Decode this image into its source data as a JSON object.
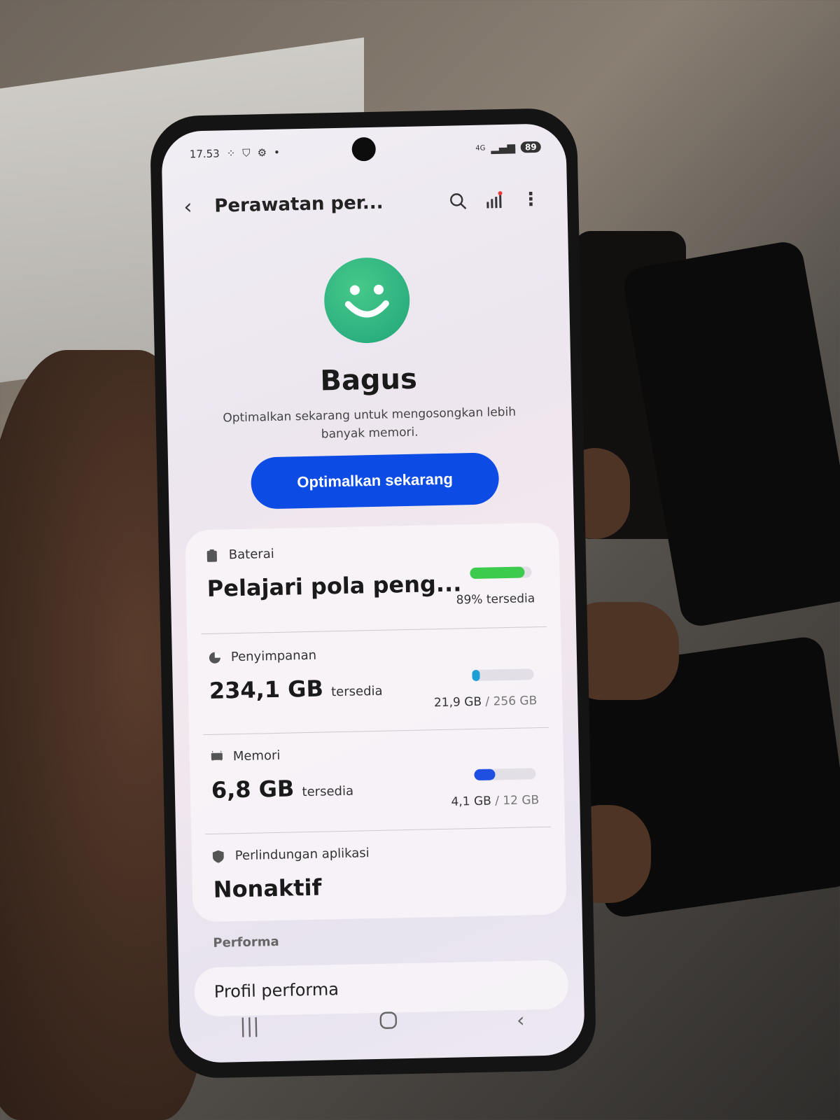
{
  "status": {
    "time": "17.53",
    "network": "4G",
    "battery": "89"
  },
  "topbar": {
    "title": "Perawatan per..."
  },
  "hero": {
    "title": "Bagus",
    "subtitle": "Optimalkan sekarang untuk mengosongkan lebih banyak memori.",
    "button": "Optimalkan sekarang"
  },
  "battery": {
    "label": "Baterai",
    "value": "Pelajari pola peng...",
    "available": "89% tersedia",
    "level": 0.89,
    "color": "#3ccb4c"
  },
  "storage": {
    "label": "Penyimpanan",
    "value": "234,1 GB",
    "unit": "tersedia",
    "used": "21,9 GB",
    "total": "/ 256 GB",
    "level": 0.086,
    "color": "#1f9fd4"
  },
  "memory": {
    "label": "Memori",
    "value": "6,8 GB",
    "unit": "tersedia",
    "used": "4,1 GB",
    "total": "/ 12 GB",
    "level": 0.34,
    "color": "#1e4fe0"
  },
  "protection": {
    "label": "Perlindungan aplikasi",
    "value": "Nonaktif"
  },
  "performance": {
    "section": "Performa",
    "item": "Profil performa"
  },
  "icons": [
    "back-icon",
    "search-icon",
    "report-icon",
    "more-icon",
    "smiley-icon",
    "battery-icon",
    "storage-icon",
    "memory-icon",
    "shield-icon"
  ]
}
